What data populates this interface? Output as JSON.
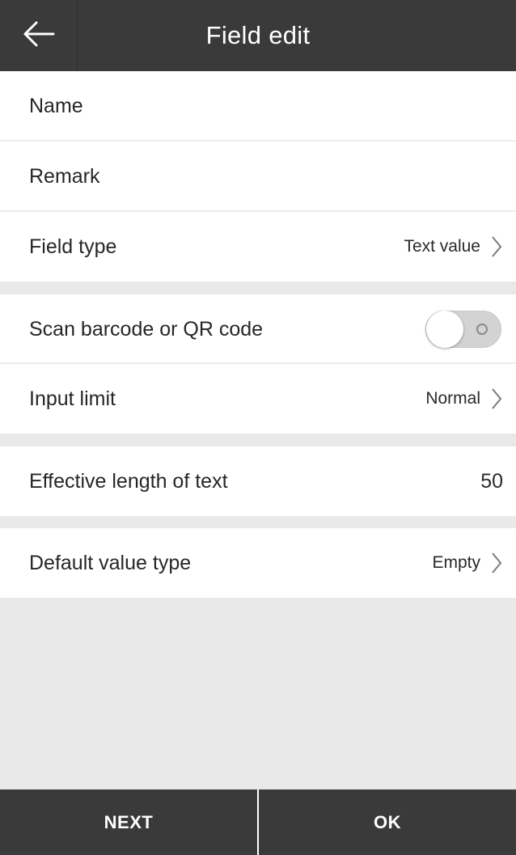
{
  "header": {
    "title": "Field edit",
    "back_icon": "arrow-left-icon"
  },
  "fields": {
    "name_label": "Name",
    "remark_label": "Remark",
    "field_type_label": "Field type",
    "field_type_value": "Text value",
    "scan_label": "Scan barcode or QR code",
    "scan_enabled": false,
    "input_limit_label": "Input limit",
    "input_limit_value": "Normal",
    "effective_length_label": "Effective length of text",
    "effective_length_value": "50",
    "default_value_type_label": "Default value type",
    "default_value_type_value": "Empty"
  },
  "footer": {
    "next_label": "NEXT",
    "ok_label": "OK"
  },
  "colors": {
    "header_bg": "#3a3a3a",
    "page_bg": "#e9e9e9",
    "row_bg": "#ffffff",
    "toggle_off": "#d3d3d3"
  }
}
